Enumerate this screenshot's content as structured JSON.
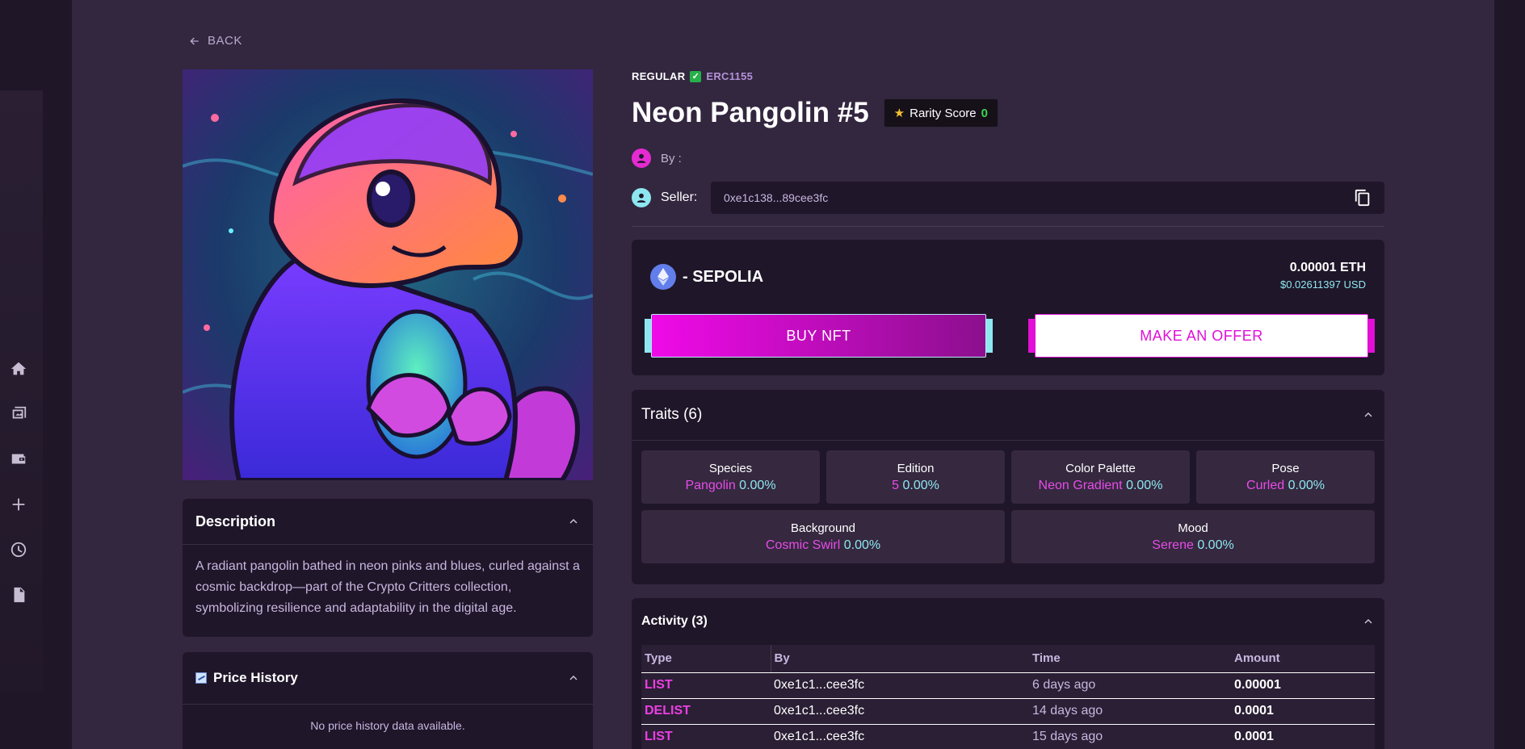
{
  "nav": {
    "icons": [
      "home-icon",
      "gallery-icon",
      "wallet-icon",
      "plus-icon",
      "clock-icon",
      "document-icon"
    ]
  },
  "back_label": "BACK",
  "nft": {
    "standard_tag": "REGULAR",
    "token_type": "ERC1155",
    "title": "Neon Pangolin #5",
    "rarity_label": "Rarity Score",
    "rarity_score": "0",
    "by_label": "By :",
    "seller_label": "Seller:",
    "seller_address": "0xe1c138...89cee3fc"
  },
  "sale": {
    "network": "- SEPOLIA",
    "price_eth": "0.00001 ETH",
    "price_usd": "$0.02611397 USD",
    "buy_label": "BUY NFT",
    "offer_label": "MAKE AN OFFER"
  },
  "traits": {
    "title": "Traits (6)",
    "items": [
      {
        "name": "Species",
        "value": "Pangolin",
        "pct": "0.00%"
      },
      {
        "name": "Edition",
        "value": "5",
        "pct": "0.00%"
      },
      {
        "name": "Color Palette",
        "value": "Neon Gradient",
        "pct": "0.00%"
      },
      {
        "name": "Pose",
        "value": "Curled",
        "pct": "0.00%"
      },
      {
        "name": "Background",
        "value": "Cosmic Swirl",
        "pct": "0.00%"
      },
      {
        "name": "Mood",
        "value": "Serene",
        "pct": "0.00%"
      }
    ]
  },
  "description": {
    "title": "Description",
    "text": "A radiant pangolin bathed in neon pinks and blues, curled against a cosmic backdrop—part of the Crypto Critters collection, symbolizing resilience and adaptability in the digital age."
  },
  "price_history": {
    "title": "Price History",
    "empty": "No price history data available."
  },
  "activity": {
    "title": "Activity (3)",
    "columns": [
      "Type",
      "By",
      "Time",
      "Amount"
    ],
    "rows": [
      {
        "type": "LIST",
        "by": "0xe1c1...cee3fc",
        "time": "6 days ago",
        "amount": "0.00001"
      },
      {
        "type": "DELIST",
        "by": "0xe1c1...cee3fc",
        "time": "14 days ago",
        "amount": "0.0001"
      },
      {
        "type": "LIST",
        "by": "0xe1c1...cee3fc",
        "time": "15 days ago",
        "amount": "0.0001"
      }
    ]
  },
  "colors": {
    "accent_pink": "#e20fd6",
    "accent_cyan": "#8de7f0",
    "panel": "#33263f",
    "card": "#1f1629"
  }
}
